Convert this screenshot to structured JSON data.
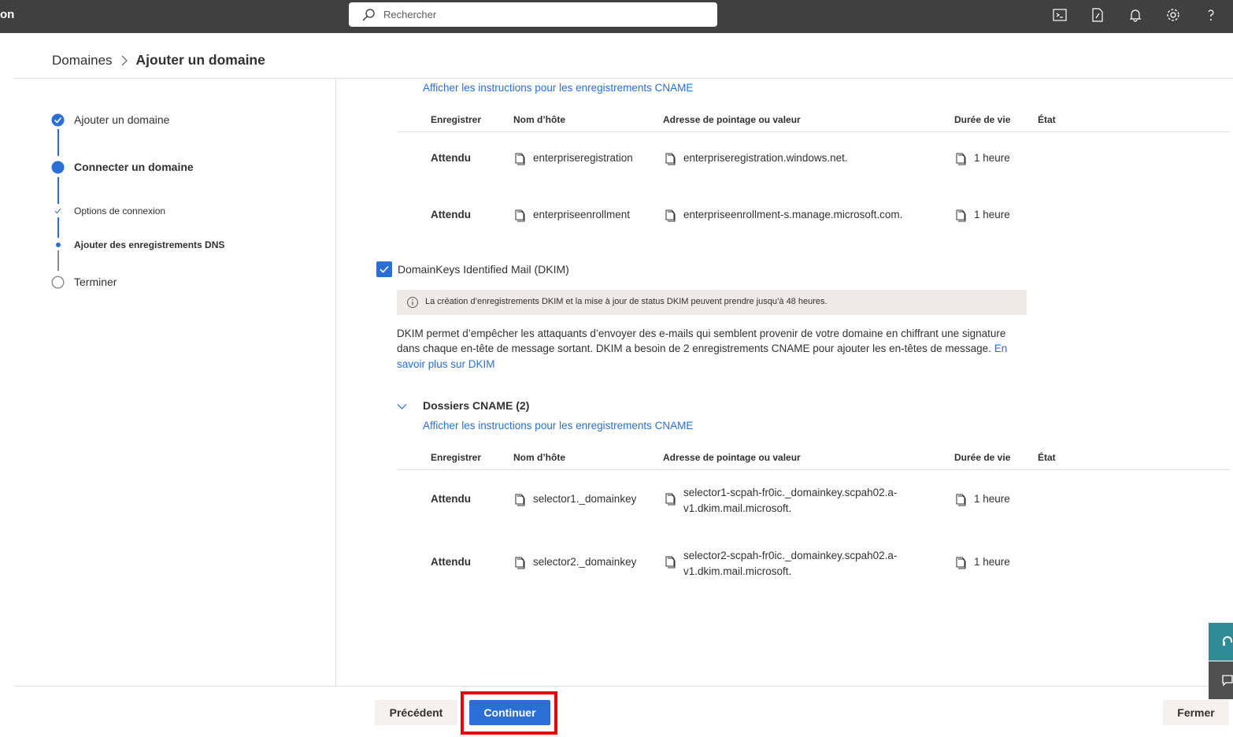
{
  "topbar": {
    "app_name": "on",
    "search_placeholder": "Rechercher",
    "icons": [
      "terminal-icon",
      "document-icon",
      "bell-icon",
      "gear-icon",
      "help-icon"
    ]
  },
  "breadcrumb": {
    "root": "Domaines",
    "current": "Ajouter un domaine"
  },
  "steps": {
    "step1": "Ajouter un domaine",
    "step2": "Connecter un domaine",
    "step2_sub1": "Options de connexion",
    "step2_sub2": "Ajouter des enregistrements DNS",
    "step3": "Terminer"
  },
  "top_section": {
    "instructions_link": "Afficher les instructions pour les enregistrements CNAME",
    "headers": {
      "record": "Enregistrer",
      "host": "Nom d’hôte",
      "value": "Adresse de pointage ou valeur",
      "ttl": "Durée de vie",
      "state": "État"
    },
    "rows": [
      {
        "status": "Attendu",
        "host": "enterpriseregistration",
        "value": "enterpriseregistration.windows.net.",
        "ttl": "1 heure"
      },
      {
        "status": "Attendu",
        "host": "enterpriseenrollment",
        "value": "enterpriseenrollment-s.manage.microsoft.com.",
        "ttl": "1 heure"
      }
    ]
  },
  "dkim": {
    "checkbox_label": "DomainKeys Identified Mail (DKIM)",
    "info_text": "La création d’enregistrements DKIM et la mise à jour de status DKIM peuvent prendre jusqu’à 48 heures.",
    "description": "DKIM permet d’empêcher les attaquants d’envoyer des e-mails qui semblent provenir de votre domaine en chiffrant une signature dans chaque en-tête de message sortant. DKIM a besoin de 2 enregistrements CNAME pour ajouter les en-têtes de message.",
    "learn_more": "En savoir plus sur DKIM",
    "section_title": "Dossiers CNAME (2)",
    "instructions_link": "Afficher les instructions pour les enregistrements CNAME",
    "headers": {
      "record": "Enregistrer",
      "host": "Nom d’hôte",
      "value": "Adresse de pointage ou valeur",
      "ttl": "Durée de vie",
      "state": "État"
    },
    "rows": [
      {
        "status": "Attendu",
        "host": "selector1._domainkey",
        "value_line1": "selector1-scpah-fr0ic._domainkey.scpah02.a-",
        "value_line2": "v1.dkim.mail.microsoft.",
        "ttl": "1 heure"
      },
      {
        "status": "Attendu",
        "host": "selector2._domainkey",
        "value_line1": "selector2-scpah-fr0ic._domainkey.scpah02.a-",
        "value_line2": "v1.dkim.mail.microsoft.",
        "ttl": "1 heure"
      }
    ]
  },
  "footer": {
    "prev": "Précédent",
    "continue": "Continuer",
    "close": "Fermer"
  },
  "colors": {
    "accent": "#2b6fd6",
    "topbar": "#404040",
    "highlight": "#e8000b"
  }
}
